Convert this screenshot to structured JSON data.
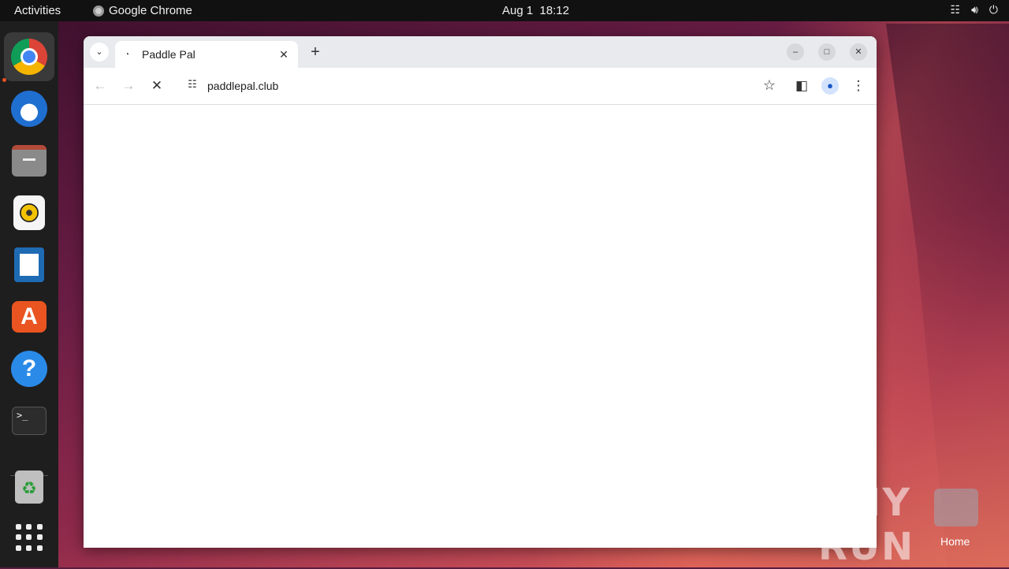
{
  "topbar": {
    "activities": "Activities",
    "app_name": "Google Chrome",
    "date": "Aug 1",
    "time": "18:12"
  },
  "dock": {
    "items": [
      {
        "name": "Google Chrome",
        "icon": "chrome-icon",
        "active": true
      },
      {
        "name": "Thunderbird",
        "icon": "thunderbird-icon"
      },
      {
        "name": "Files",
        "icon": "files-icon"
      },
      {
        "name": "Rhythmbox",
        "icon": "rhythmbox-icon"
      },
      {
        "name": "LibreOffice Writer",
        "icon": "writer-icon"
      },
      {
        "name": "Ubuntu Software",
        "icon": "software-icon"
      },
      {
        "name": "Help",
        "icon": "help-icon"
      },
      {
        "name": "Terminal",
        "icon": "terminal-icon"
      },
      {
        "name": "Trash",
        "icon": "trash-icon"
      },
      {
        "name": "Show Applications",
        "icon": "app-grid-icon"
      }
    ]
  },
  "browser": {
    "tab": {
      "title": "Paddle Pal",
      "favicon": "loading-icon"
    },
    "address": {
      "url": "paddlepal.club"
    },
    "accent": "#1a73e8"
  },
  "desktop": {
    "home_label": "Home",
    "watermark": "ANY RUN"
  }
}
